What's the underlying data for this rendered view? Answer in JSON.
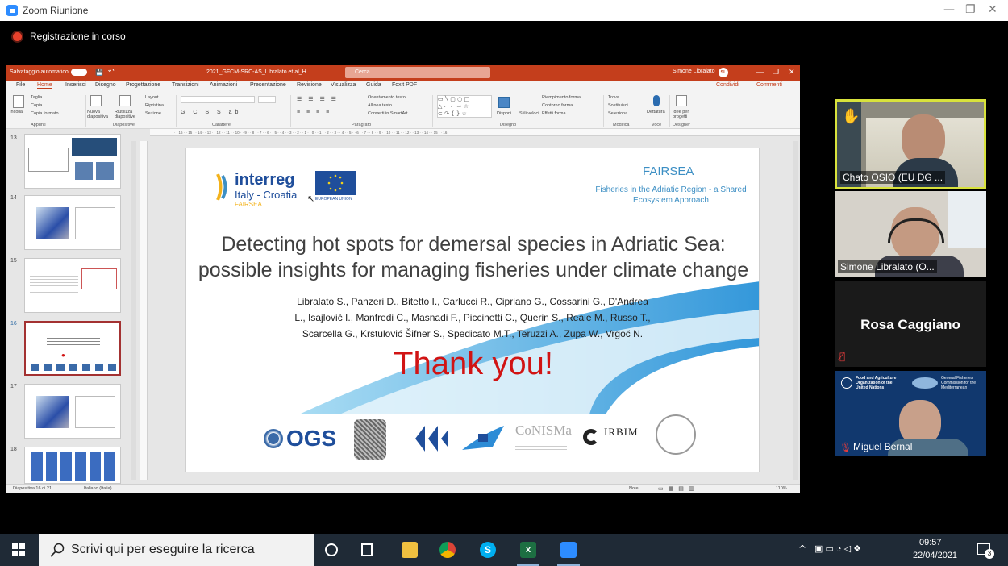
{
  "zoom": {
    "window_title": "Zoom Riunione",
    "recording": "Registrazione in corso"
  },
  "ppt": {
    "autosave": "Salvataggio automatico",
    "filename": "2021_GFCM-SRC-AS_Libralato et al_H...",
    "search": "Cerca",
    "user": "Simone Libralato",
    "user_initials": "SL",
    "menu": [
      "File",
      "Home",
      "Inserisci",
      "Disegno",
      "Progettazione",
      "Transizioni",
      "Animazioni",
      "Presentazione",
      "Revisione",
      "Visualizza",
      "Guida",
      "Foxit PDF"
    ],
    "share": "Condividi",
    "comments": "Commenti",
    "ribbon": {
      "appunti": "Appunti",
      "incolla": "Incolla",
      "taglia": "Taglia",
      "copia": "Copia",
      "copia_formato": "Copia formato",
      "nuova_diapositiva": "Nuova diapositiva",
      "riutilizza": "Riutilizza diapositive",
      "diapositive": "Diapositive",
      "layout": "Layout",
      "ripristina": "Ripristina",
      "sezione": "Sezione",
      "carattere": "Carattere",
      "paragrafo": "Paragrafo",
      "orientamento": "Orientamento testo",
      "allinea": "Allinea testo",
      "smartart": "Converti in SmartArt",
      "disegno": "Disegno",
      "disponi": "Disponi",
      "stili": "Stili veloci",
      "riempimento": "Riempimento forma",
      "contorno": "Contorno forma",
      "effetti": "Effetti forma",
      "trova": "Trova",
      "sostituisci": "Sostituisci",
      "seleziona": "Seleziona",
      "modifica": "Modifica",
      "dettatura": "Dettatura",
      "voce": "Voce",
      "idee": "Idee per progetti",
      "designer": "Designer"
    },
    "thumbnails": [
      {
        "num": "13"
      },
      {
        "num": "14"
      },
      {
        "num": "15"
      },
      {
        "num": "16"
      },
      {
        "num": "17"
      },
      {
        "num": "18"
      }
    ],
    "status": {
      "slide_count": "Diapositiva 16 di 21",
      "language": "Italiano (Italia)",
      "notes": "Note",
      "zoom": "110%"
    }
  },
  "slide": {
    "interreg": "interreg",
    "interreg_sub": "Italy - Croatia",
    "fairsea_small": "FAIRSEA",
    "eu": "EUROPEAN UNION",
    "fairsea": "FAIRSEA",
    "fairsea_sub": "Fisheries in the Adriatic Region - a Shared Ecosystem Approach",
    "title_line1": "Detecting hot spots for demersal species in Adriatic Sea:",
    "title_line2": "possible insights for managing fisheries under climate change",
    "authors_line1": "Libralato S., Panzeri D., Bitetto I., Carlucci R., Cipriano G., Cossarini G., D'Andrea",
    "authors_line2": "L., Isajlović I., Manfredi C., Masnadi F., Piccinetti C., Querin S., Reale M., Russo T.,",
    "authors_line3": "Scarcella G., Krstulović Šifner S., Spedicato M.T., Teruzzi A., Zupa W., Vrgoč N.",
    "thanks": "Thank you!",
    "logo_ogs": "OGS",
    "logo_conisma": "CoNISMa",
    "logo_irbim": "IRBIM"
  },
  "participants": [
    {
      "name": "Chato OSIO (EU DG ...",
      "hand_raised": true
    },
    {
      "name": "Simone Libralato (O..."
    },
    {
      "name": "Rosa Caggiano",
      "muted": true
    },
    {
      "name": "Miguel Bernal",
      "muted": true,
      "fao_text": "Food and Agriculture Organization of the United Nations",
      "gfcm_text": "General Fisheries Commission for the Mediterranean"
    }
  ],
  "taskbar": {
    "search_placeholder": "Scrivi qui per eseguire la ricerca",
    "time": "09:57",
    "date": "22/04/2021",
    "notifications": "3"
  },
  "colors": {
    "ppt_red": "#c43e1c",
    "zoom_blue": "#2d8cff",
    "hand_border": "#d8e23c",
    "thanks_red": "#d11414"
  }
}
